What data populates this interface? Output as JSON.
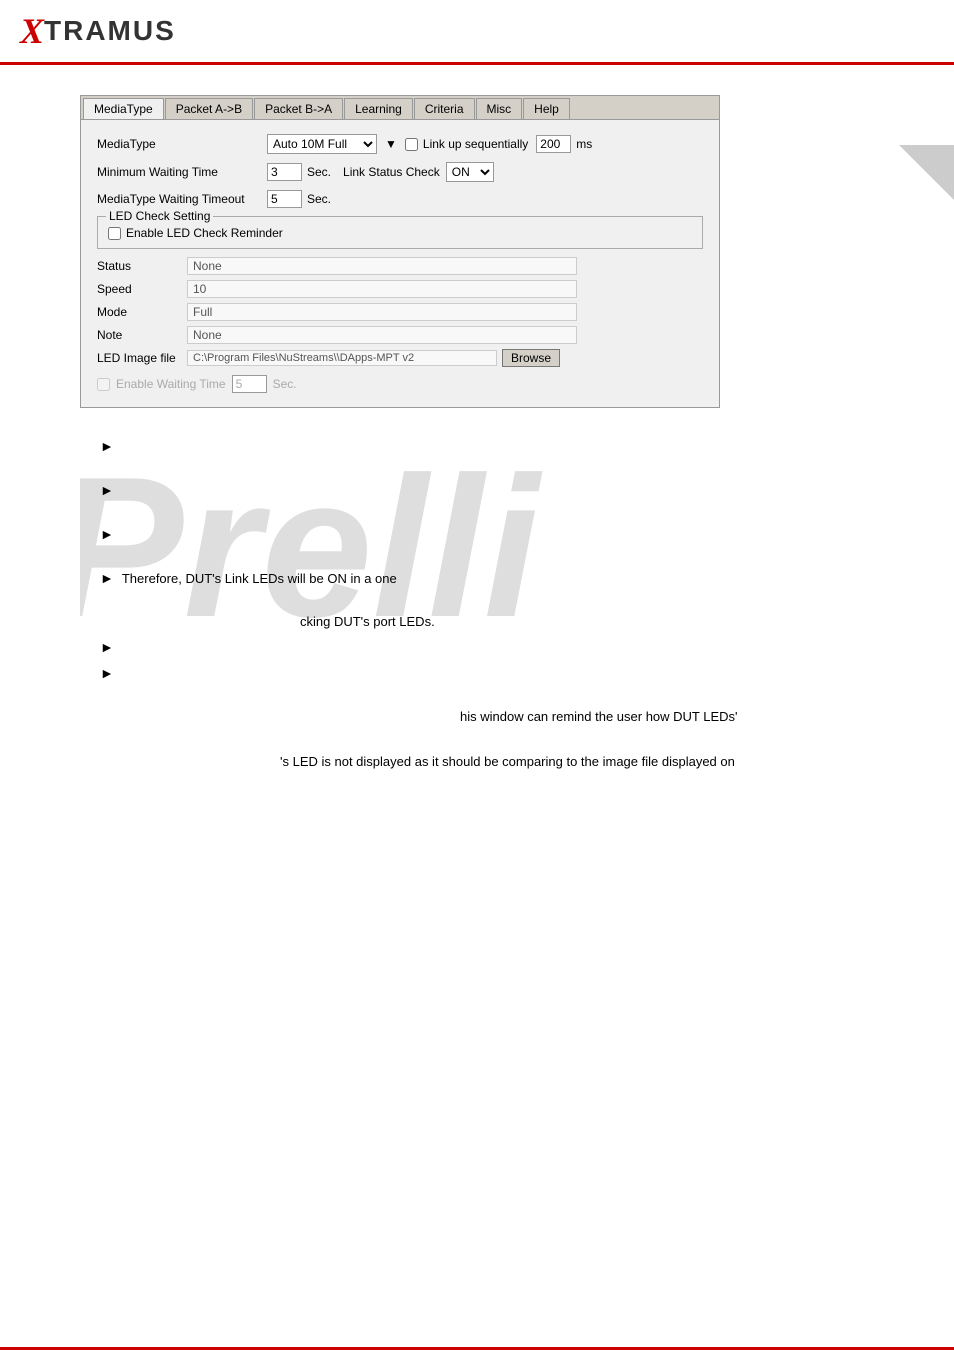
{
  "header": {
    "logo_x": "X",
    "logo_text": "TRAMUS"
  },
  "dialog": {
    "tabs": [
      {
        "label": "MediaType",
        "active": true
      },
      {
        "label": "Packet A->B"
      },
      {
        "label": "Packet B->A"
      },
      {
        "label": "Learning"
      },
      {
        "label": "Criteria"
      },
      {
        "label": "Misc"
      },
      {
        "label": "Help"
      }
    ],
    "mediatype_label": "MediaType",
    "mediatype_value": "Auto 10M Full",
    "link_up_label": "Link up sequentially",
    "link_up_ms": "200",
    "link_up_ms_unit": "ms",
    "min_wait_label": "Minimum Waiting Time",
    "min_wait_value": "3",
    "min_wait_unit": "Sec.",
    "link_status_label": "Link Status Check",
    "link_status_value": "ON",
    "mediatype_timeout_label": "MediaType Waiting Timeout",
    "mediatype_timeout_value": "5",
    "mediatype_timeout_unit": "Sec.",
    "led_group_legend": "LED Check Setting",
    "enable_led_label": "Enable LED Check Reminder",
    "status_label": "Status",
    "status_value": "None",
    "speed_label": "Speed",
    "speed_value": "10",
    "mode_label": "Mode",
    "mode_value": "Full",
    "note_label": "Note",
    "note_value": "None",
    "led_image_label": "LED Image file",
    "led_image_path": "C:\\Program Files\\NuStreams\\\\DApps-MPT v2",
    "browse_label": "Browse",
    "enable_waiting_label": "Enable Waiting Time",
    "enable_waiting_value": "5",
    "enable_waiting_unit": "Sec."
  },
  "bullets": [
    {
      "text": ""
    },
    {
      "text": ""
    },
    {
      "text": ""
    },
    {
      "text": ""
    }
  ],
  "paragraphs": {
    "para1": "Therefore, DUT's Link LEDs will be ON in a one",
    "para2": "cking DUT's port LEDs.",
    "para3": "his window can remind the user how DUT LEDs'",
    "para4": "'s LED is not displayed as it should be comparing to the image file displayed on"
  },
  "watermark": "Prelli"
}
